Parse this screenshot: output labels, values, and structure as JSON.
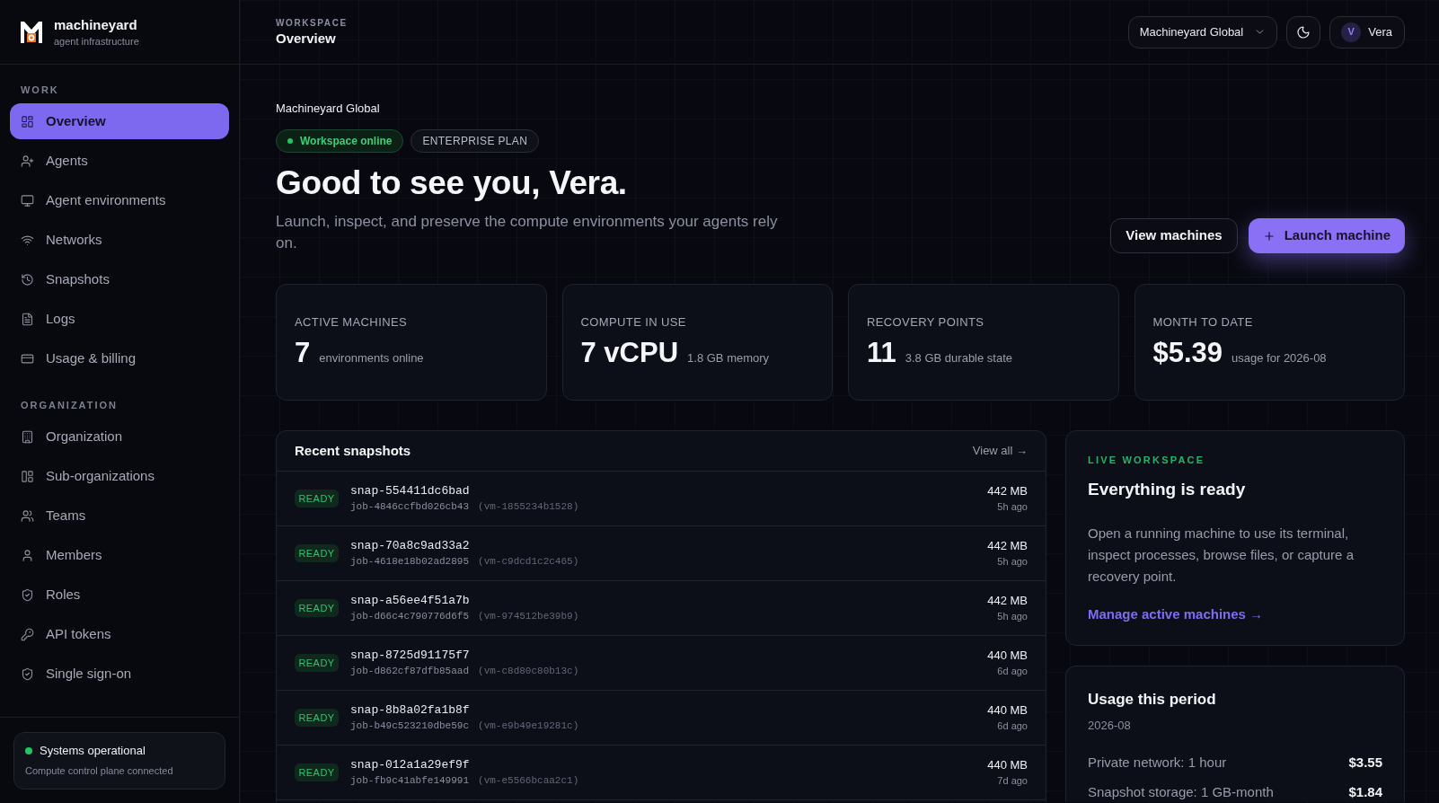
{
  "brand": {
    "name": "machineyard",
    "tagline": "agent infrastructure"
  },
  "sidebar": {
    "sections": [
      {
        "title": "WORK",
        "items": [
          {
            "label": "Overview",
            "selected": true
          },
          {
            "label": "Agents",
            "selected": false
          },
          {
            "label": "Agent environments",
            "selected": false
          },
          {
            "label": "Networks",
            "selected": false
          },
          {
            "label": "Snapshots",
            "selected": false
          },
          {
            "label": "Logs",
            "selected": false
          },
          {
            "label": "Usage & billing",
            "selected": false
          }
        ]
      },
      {
        "title": "ORGANIZATION",
        "items": [
          {
            "label": "Organization",
            "selected": false
          },
          {
            "label": "Sub-organizations",
            "selected": false
          },
          {
            "label": "Teams",
            "selected": false
          },
          {
            "label": "Members",
            "selected": false
          },
          {
            "label": "Roles",
            "selected": false
          },
          {
            "label": "API tokens",
            "selected": false
          },
          {
            "label": "Single sign-on",
            "selected": false
          }
        ]
      }
    ],
    "status": {
      "title": "Systems operational",
      "detail": "Compute control plane connected"
    }
  },
  "header": {
    "eyebrow": "WORKSPACE",
    "title": "Overview",
    "org_select": {
      "value": "Machineyard Global"
    },
    "user": {
      "initial": "V",
      "name": "Vera"
    }
  },
  "hero": {
    "org": "Machineyard Global",
    "badges": [
      {
        "kind": "status",
        "label": "Workspace online"
      },
      {
        "kind": "plain",
        "label": "ENTERPRISE PLAN"
      }
    ],
    "heading": "Good to see you, Vera.",
    "subtitle": "Launch, inspect, and preserve the compute environments your agents rely on.",
    "actions": [
      {
        "kind": "secondary",
        "label": "View machines"
      },
      {
        "kind": "primary",
        "label": "Launch machine"
      }
    ]
  },
  "stats": [
    {
      "label": "ACTIVE MACHINES",
      "value": "7",
      "detail": "environments online"
    },
    {
      "label": "COMPUTE IN USE",
      "value": "7 vCPU",
      "detail": "1.8 GB memory"
    },
    {
      "label": "RECOVERY POINTS",
      "value": "11",
      "detail": "3.8 GB durable state"
    },
    {
      "label": "MONTH TO DATE",
      "value": "$5.39",
      "detail": "usage for 2026-08"
    }
  ],
  "snapshots": {
    "title": "Recent snapshots",
    "view_all": "View all →",
    "rows": [
      {
        "status": "READY",
        "name": "snap-554411dc6bad",
        "job": "job-4846ccfbd026cb43",
        "vm": "(vm-1855234b1528)",
        "size": "442 MB",
        "age": "5h ago"
      },
      {
        "status": "READY",
        "name": "snap-70a8c9ad33a2",
        "job": "job-4618e18b02ad2895",
        "vm": "(vm-c9dcd1c2c465)",
        "size": "442 MB",
        "age": "5h ago"
      },
      {
        "status": "READY",
        "name": "snap-a56ee4f51a7b",
        "job": "job-d66c4c790776d6f5",
        "vm": "(vm-974512be39b9)",
        "size": "442 MB",
        "age": "5h ago"
      },
      {
        "status": "READY",
        "name": "snap-8725d91175f7",
        "job": "job-d862cf87dfb85aad",
        "vm": "(vm-c8d80c80b13c)",
        "size": "440 MB",
        "age": "6d ago"
      },
      {
        "status": "READY",
        "name": "snap-8b8a02fa1b8f",
        "job": "job-b49c523210dbe59c",
        "vm": "(vm-e9b49e19281c)",
        "size": "440 MB",
        "age": "6d ago"
      },
      {
        "status": "READY",
        "name": "snap-012a1a29ef9f",
        "job": "job-fb9c41abfe149991",
        "vm": "(vm-e5566bcaa2c1)",
        "size": "440 MB",
        "age": "7d ago"
      }
    ]
  },
  "live": {
    "eyebrow": "LIVE WORKSPACE",
    "title": "Everything is ready",
    "body": "Open a running machine to use its terminal, inspect processes, browse files, or capture a recovery point.",
    "link": "Manage active machines →"
  },
  "usage": {
    "title": "Usage this period",
    "period": "2026-08",
    "lines": [
      {
        "label": "Private network: 1 hour",
        "amount": "$3.55"
      },
      {
        "label": "Snapshot storage: 1 GB-month",
        "amount": "$1.84"
      }
    ]
  }
}
